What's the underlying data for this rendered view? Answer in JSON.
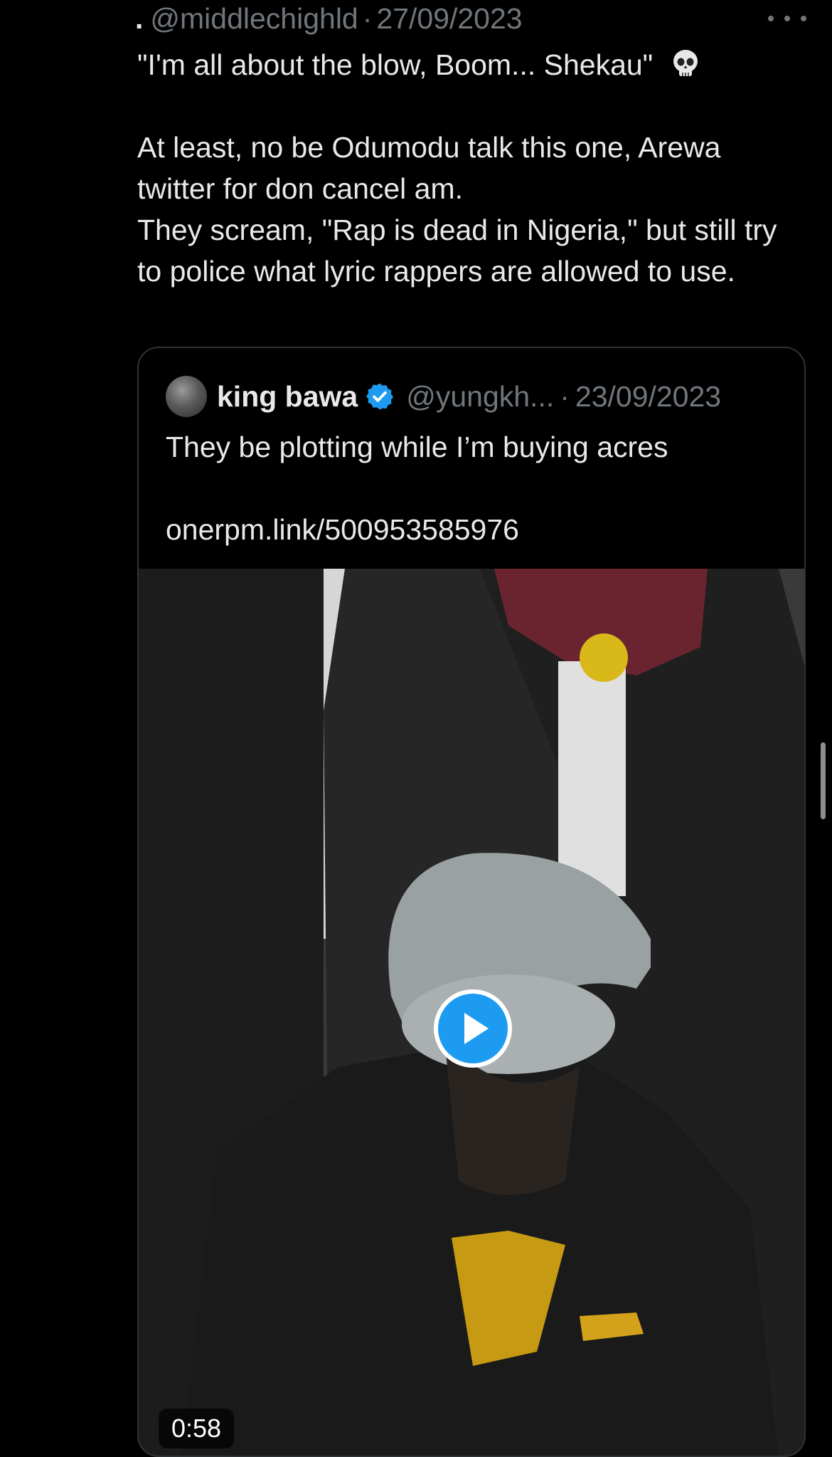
{
  "tweet": {
    "display_name": ".",
    "handle": "@middlechighld",
    "separator": "·",
    "date": "27/09/2023",
    "text_lines": [
      "\"I'm all about the blow, Boom... Shekau\"",
      "",
      "At least, no be Odumodu talk this one, Arewa twitter for don cancel am.",
      "They scream, \"Rap is dead in Nigeria,\" but still try to police what lyric rappers are allowed to use."
    ],
    "emoji": "skull-icon"
  },
  "quote": {
    "display_name": "king bawa",
    "handle": "@yungkh...",
    "separator": "·",
    "date": "23/09/2023",
    "text_line_1": "They be plotting while I’m buying acres",
    "text_line_2": "onerpm.link/500953585976",
    "video": {
      "duration": "0:58",
      "play_icon": "play-icon"
    }
  },
  "colors": {
    "background": "#000000",
    "text": "#e7e9ea",
    "muted": "#71767b",
    "border": "#2f3336",
    "accent": "#1d9bf0"
  }
}
